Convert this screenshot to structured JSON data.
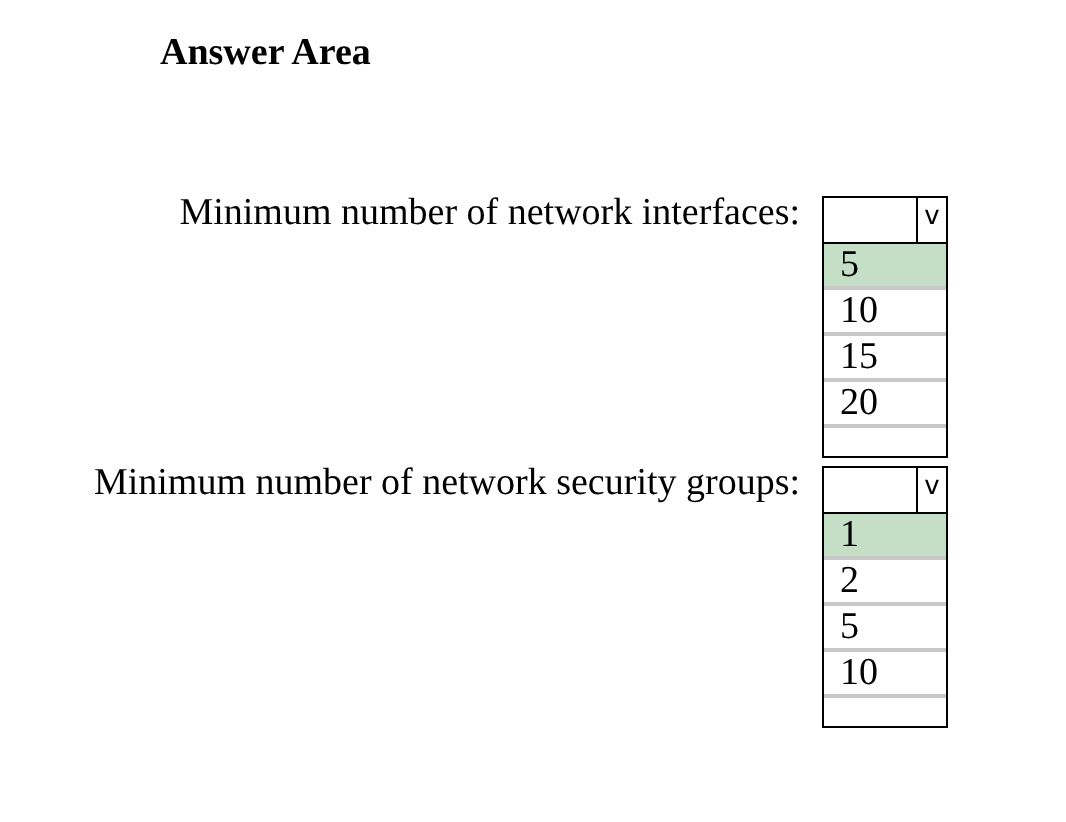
{
  "title": "Answer Area",
  "questions": [
    {
      "label": "Minimum number of network interfaces:",
      "caret": "v",
      "options": [
        {
          "text": "5",
          "selected": true
        },
        {
          "text": "10",
          "selected": false
        },
        {
          "text": "15",
          "selected": false
        },
        {
          "text": "20",
          "selected": false
        }
      ]
    },
    {
      "label": "Minimum number of network security groups:",
      "caret": "v",
      "options": [
        {
          "text": "1",
          "selected": true
        },
        {
          "text": "2",
          "selected": false
        },
        {
          "text": "5",
          "selected": false
        },
        {
          "text": "10",
          "selected": false
        }
      ]
    }
  ]
}
